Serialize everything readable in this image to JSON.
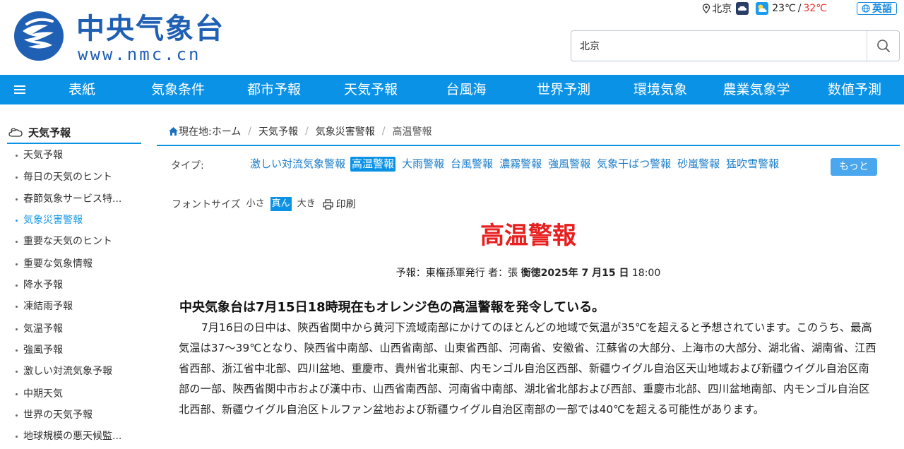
{
  "header": {
    "site_name": "中央气象台",
    "site_url": "www.nmc.cn",
    "location": "北京",
    "temp_low": "23℃",
    "temp_sep": "/",
    "temp_high": "32℃",
    "language_button": "英語",
    "search_value": "北京",
    "colors": {
      "brand": "#1f5fb4",
      "nav": "#0a92e6",
      "hot": "#e8302a"
    }
  },
  "nav": {
    "items": [
      "表紙",
      "気象条件",
      "都市予報",
      "天気予報",
      "台風海",
      "世界予測",
      "環境気象",
      "農業気象学",
      "数値予測"
    ]
  },
  "sidebar": {
    "heading": "天気予報",
    "items": [
      {
        "label": "天気予報",
        "active": false
      },
      {
        "label": "毎日の天気のヒント",
        "active": false
      },
      {
        "label": "春節気象サービス特...",
        "active": false
      },
      {
        "label": "気象災害警報",
        "active": true
      },
      {
        "label": "重要な天気のヒント",
        "active": false
      },
      {
        "label": "重要な気象情報",
        "active": false
      },
      {
        "label": "降水予報",
        "active": false
      },
      {
        "label": "凍結雨予報",
        "active": false
      },
      {
        "label": "気温予報",
        "active": false
      },
      {
        "label": "強風予報",
        "active": false
      },
      {
        "label": "激しい対流気象予報",
        "active": false
      },
      {
        "label": "中期天気",
        "active": false
      },
      {
        "label": "世界の天気予報",
        "active": false
      },
      {
        "label": "地球規模の悪天候監...",
        "active": false
      }
    ]
  },
  "breadcrumb": {
    "prefix": "現在地:ホーム",
    "items": [
      "天気予報",
      "気象災害警報"
    ],
    "current": "高温警報"
  },
  "types": {
    "label": "タイプ:",
    "items": [
      {
        "label": "激しい対流気象警報",
        "active": false
      },
      {
        "label": "高温警報",
        "active": true
      },
      {
        "label": "大雨警報",
        "active": false
      },
      {
        "label": "台風警報",
        "active": false
      },
      {
        "label": "濃霧警報",
        "active": false
      },
      {
        "label": "強風警報",
        "active": false
      },
      {
        "label": "気象干ばつ警報",
        "active": false
      },
      {
        "label": "砂嵐警報",
        "active": false
      },
      {
        "label": "猛吹雪警報",
        "active": false
      }
    ],
    "more": "もっと"
  },
  "font_size": {
    "label": "フォントサイズ",
    "small": "小さ",
    "medium": "真ん",
    "large": "大き",
    "print": "印刷"
  },
  "article": {
    "title": "高温警報",
    "meta_prefix": "予報：東権孫軍発行 者：張 ",
    "meta_bold": "衡徳2025年 7 月15 日",
    "meta_time": " 18:00",
    "lead": "中央気象台は7月15日18時現在もオレンジ色の高温警報を発令している。",
    "body": "7月16日の日中は、陝西省関中から黄河下流域南部にかけてのほとんどの地域で気温が35℃を超えると予想されています。このうち、最高気温は37～39℃となり、陝西省中南部、山西省南部、山東省西部、河南省、安徽省、江蘇省の大部分、上海市の大部分、湖北省、湖南省、江西省西部、浙江省中北部、四川盆地、重慶市、貴州省北東部、内モンゴル自治区西部、新疆ウイグル自治区天山地域および新疆ウイグル自治区南部の一部、陝西省関中市および漢中市、山西省南西部、河南省中南部、湖北省北部および西部、重慶市北部、四川盆地南部、内モンゴル自治区北西部、新疆ウイグル自治区トルファン盆地および新疆ウイグル自治区南部の一部では40℃を超える可能性があります。"
  }
}
